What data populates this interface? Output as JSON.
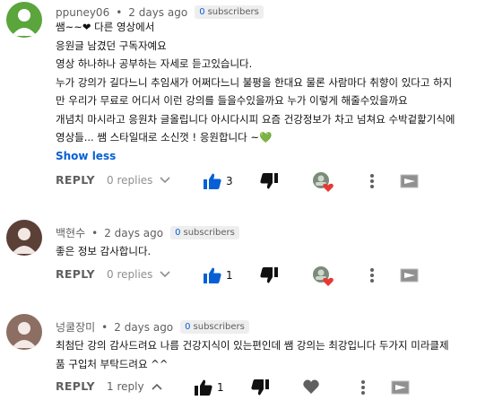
{
  "colors": {
    "accent": "#065fd4",
    "like": "#065fd4",
    "muted": "#606060",
    "heart": "#e53935",
    "green_heart": "#6ac259"
  },
  "comments": [
    {
      "author": "ppuney06",
      "time": "2 days ago",
      "subs_count": "0",
      "subs_label": "subscribers",
      "avatar_color": "#5aa53c",
      "lines": [
        "쌤~~❤ 다른 영상에서",
        "응원글 남겼던 구독자예요",
        "영상 하나하나 공부하는 자세로 듣고있습니다.",
        "누가 강의가 길다느니 추임새가 어쩌다느니 불평을 한대요 물론 사람마다 취향이 있다고 하지",
        "만 우리가 무료로 어디서 이런 강의를 들을수있을까요 누가 이렇게 해줄수있을까요",
        "개념치 마시라고 응원차 글올립니다 아시다시피 요즘 건강정보가 차고 넘쳐요 수박겉핥기식에",
        "영상들... 쌤 스타일대로 소신껏 ! 응원합니다 ~💚"
      ],
      "show_less": "Show less",
      "reply_label": "REPLY",
      "replies_label": "0 replies",
      "likes": "3",
      "liked": true,
      "creator_heart": true
    },
    {
      "author": "백현수",
      "time": "2 days ago",
      "subs_count": "0",
      "subs_label": "subscribers",
      "avatar_color": "#5a4037",
      "lines": [
        "좋은 정보 감사합니다."
      ],
      "reply_label": "REPLY",
      "replies_label": "0 replies",
      "likes": "1",
      "liked": true,
      "creator_heart": true
    },
    {
      "author": "넝쿨장미",
      "time": "2 days ago",
      "subs_count": "0",
      "subs_label": "subscribers",
      "avatar_color": "#8d6e63",
      "lines": [
        "최첨단 강의 감사드려요 나름 건강지식이 있는편인데 쌤 강의는 최강입니다  두가지 미라클제",
        "품 구입처 부탁드려요 ^^"
      ],
      "reply_label": "REPLY",
      "replies_label": "1 reply",
      "likes": "1",
      "liked": false,
      "creator_heart": false
    }
  ],
  "icons": {
    "like": "thumbs-up-icon",
    "dislike": "thumbs-down-icon",
    "creator_heart": "creator-heart-icon",
    "heart": "heart-icon",
    "more": "more-vertical-icon",
    "share": "share-icon",
    "chevron_down": "chevron-down-icon",
    "chevron_up": "chevron-up-icon"
  }
}
